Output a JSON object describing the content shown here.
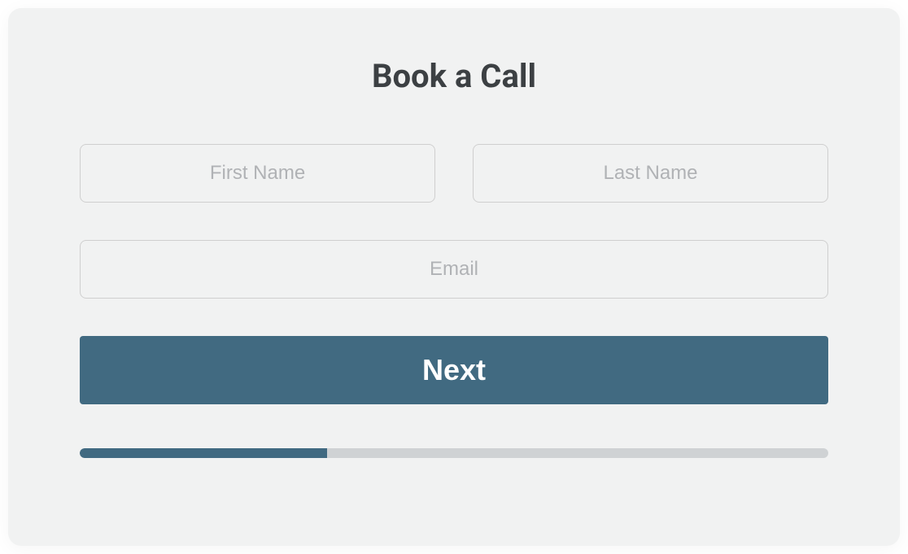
{
  "form": {
    "title": "Book a Call",
    "first_name_placeholder": "First Name",
    "last_name_placeholder": "Last Name",
    "email_placeholder": "Email",
    "next_label": "Next",
    "first_name_value": "",
    "last_name_value": "",
    "email_value": ""
  },
  "progress": {
    "percent": 33
  }
}
